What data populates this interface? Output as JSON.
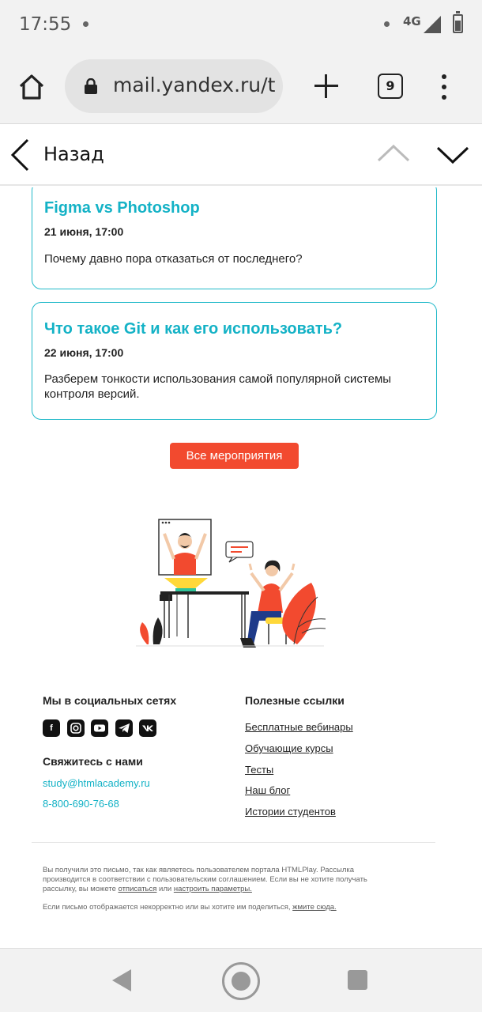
{
  "status_bar": {
    "time": "17:55",
    "network": "4G"
  },
  "browser": {
    "url": "mail.yandex.ru/touch",
    "tab_count": "9"
  },
  "mail_header": {
    "back_label": "Назад"
  },
  "events": [
    {
      "title": "Figma vs Photoshop",
      "date": "21 июня, 17:00",
      "description": "Почему давно пора отказаться от последнего?"
    },
    {
      "title": "Что такое Git и как его использовать?",
      "date": "22 июня, 17:00",
      "description": "Разберем тонкости использования самой популярной системы контроля версий."
    }
  ],
  "all_events_button": "Все мероприятия",
  "footer": {
    "social_heading": "Мы в социальных сетях",
    "social_icons": [
      "facebook-icon",
      "instagram-icon",
      "youtube-icon",
      "telegram-icon",
      "vk-icon"
    ],
    "contact_heading": "Свяжитесь с нами",
    "email": "study@htmlacademy.ru",
    "phone": "8-800-690-76-68",
    "links_heading": "Полезные ссылки",
    "links": [
      "Бесплатные вебинары",
      "Обучающие курсы",
      "Тесты",
      "Наш блог",
      "Истории студентов"
    ],
    "legal_1": "Вы получили это письмо, так как являетесь пользователем портала HTMLPlay. Рассылка производится в соответствии с пользовательским соглашением. Если вы не хотите получать рассылку, вы можете",
    "legal_unsubscribe": "отписаться",
    "legal_or": "или",
    "legal_settings": "настроить параметры.",
    "legal_2": "Если письмо отображается некорректно или вы хотите им поделиться,",
    "legal_click_here": "жмите сюда."
  },
  "colors": {
    "accent": "#14b2c6",
    "button": "#f24a2f"
  }
}
